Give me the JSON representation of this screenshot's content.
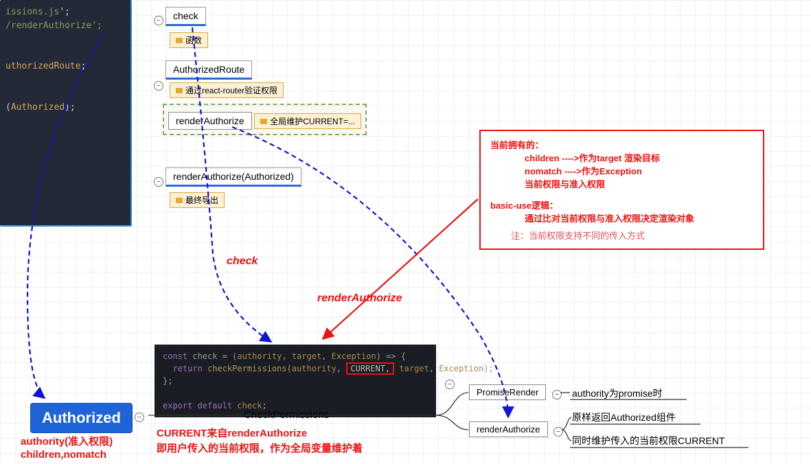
{
  "codeTop": {
    "l1a": "issions.js",
    "l1b": "';",
    "l2": "/renderAuthorize';",
    "l3a": "uthorizedRoute",
    "l3b": ";",
    "l4a": "(",
    "l4b": "Authorized",
    "l4c": ");"
  },
  "nodes": {
    "check": "check",
    "check_tag": "函数",
    "authRoute": "AuthorizedRoute",
    "authRoute_tag": "通过react-router验证权限",
    "renderAuth": "renderAuthorize",
    "renderAuth_tag": "全局维护CURRENT=...",
    "renderAuthCall": "renderAuthorize(Authorized)",
    "renderAuthCall_tag": "最终导出"
  },
  "labels": {
    "check": "check",
    "renderAuth": "renderAuthorize"
  },
  "redbox": {
    "h1": "当前拥有的：",
    "l1": "children ---->作为target 渲染目标",
    "l2": "nomatch ---->作为Exception",
    "l3": "当前权限与准入权限",
    "h2": "basic-use逻辑：",
    "l4": "通过比对当前权限与准入权限决定渲染对象",
    "note": "注：当前权限支持不同的传入方式"
  },
  "chkCode": {
    "l1a": "const",
    "l1b": " check = (",
    "l1c": "authority",
    "l1d": ", ",
    "l1e": "target",
    "l1f": ", ",
    "l1g": "Exception",
    "l1h": ") => {",
    "l2a": "  return ",
    "l2b": "checkPermissions",
    "l2c": "(",
    "l2d": "authority",
    "l2e": ", ",
    "l2f": "CURRENT,",
    "l2g": " ",
    "l2h": "target",
    "l2i": ", ",
    "l2j": "Exception",
    "l2k": ");",
    "l3": "};",
    "l4a": "export default ",
    "l4b": "check",
    "l4c": ";"
  },
  "bottom": {
    "authorized": "Authorized",
    "authLine1": "authority(准入权限)",
    "authLine2": "children,nomatch",
    "checkPerm": "CheckPermissions",
    "curNote1": "CURRENT来自renderAuthorize",
    "curNote2": "即用户传入的当前权限，作为全局变量维护着"
  },
  "right": {
    "promiseRender": "PromiseRender",
    "promiseNote": "authority为promise时",
    "renderAuth": "renderAuthorize",
    "raNote1": "原样返回Authorized组件",
    "raNote2": "同时维护传入的当前权限CURRENT"
  },
  "minus": "−"
}
